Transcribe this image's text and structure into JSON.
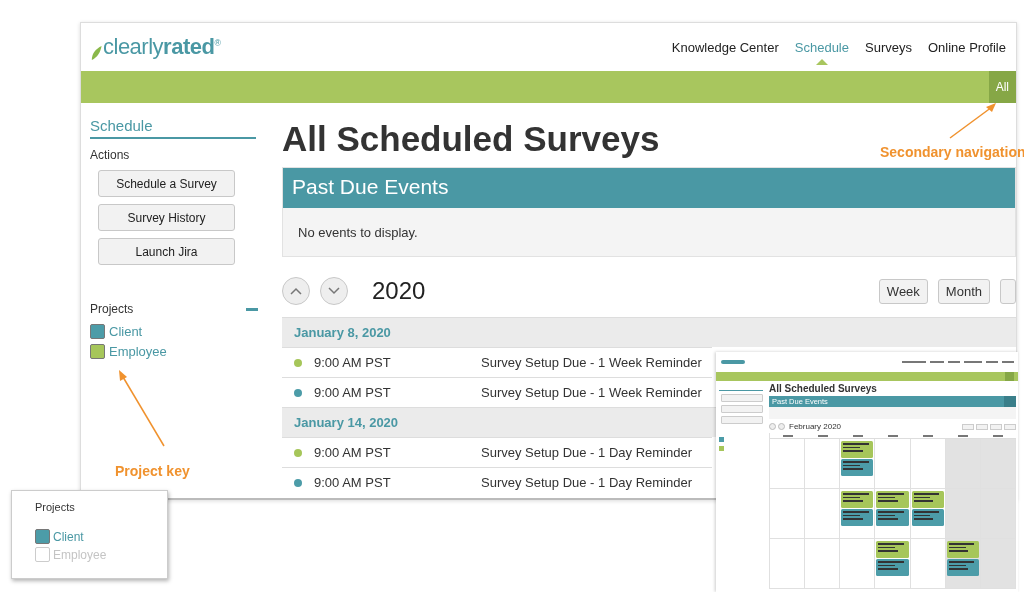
{
  "header": {
    "logo": "clearly**rated**$^{®}$",
    "nav": [
      {
        "label": "Knowledge Center",
        "selected": false
      },
      {
        "label": "Schedule",
        "selected": true
      },
      {
        "label": "Surveys",
        "selected": false
      },
      {
        "label": "Online Profile",
        "selected": false
      }
    ],
    "subnav": [
      {
        "label": "All",
        "selected": true
      }
    ]
  },
  "sidebar": {
    "title": "Schedule",
    "actions_label": "Actions",
    "actions": [
      "Schedule a Survey",
      "Survey History",
      "Launch Jira"
    ],
    "projects_label": "Projects",
    "projects": [
      {
        "label": "Client",
        "color": "#4c9ca8"
      },
      {
        "label": "Employee",
        "color": "#a6c65a"
      }
    ]
  },
  "page_title": "All Scheduled Surveys",
  "past_due": {
    "title": "Past Due Events",
    "empty": "No events to display."
  },
  "calendar": {
    "year": "2020",
    "views": [
      "Week",
      "Month"
    ],
    "groups": [
      {
        "date": "January 8, 2020",
        "events": [
          {
            "time": "9:00 AM PST",
            "title": "Survey Setup Due - 1 Week Reminder",
            "color": "#a6c65a"
          },
          {
            "time": "9:00 AM PST",
            "title": "Survey Setup Due - 1 Week Reminder",
            "color": "#4c9ca8"
          }
        ]
      },
      {
        "date": "January 14, 2020",
        "events": [
          {
            "time": "9:00 AM PST",
            "title": "Survey Setup Due - 1 Day Reminder",
            "color": "#a6c65a"
          },
          {
            "time": "9:00 AM PST",
            "title": "Survey Setup Due - 1 Day Reminder",
            "color": "#4c9ca8"
          }
        ]
      }
    ]
  },
  "annotations": [
    {
      "text": "Secondary navigation"
    },
    {
      "text": "Project key"
    }
  ],
  "projects_inset": {
    "title": "Projects",
    "items": [
      {
        "label": "Client",
        "checked": true,
        "color": "#4c9ca8"
      },
      {
        "label": "Employee",
        "checked": false
      }
    ]
  },
  "month_inset": {
    "page_title": "All Scheduled Surveys",
    "past_due_title": "Past Due Events",
    "month": "February 2020",
    "projects": [
      {
        "color": "#4c9ca8"
      },
      {
        "color": "#a6c65a"
      }
    ],
    "weeks": [
      [
        {
          "weekend": false
        },
        {
          "weekend": false
        },
        {
          "weekend": false,
          "events": [
            {
              "color": "#a6c65a"
            },
            {
              "color": "#4c9ca8"
            }
          ]
        },
        {
          "weekend": false
        },
        {
          "weekend": false
        },
        {
          "weekend": true
        },
        {
          "weekend": true
        }
      ],
      [
        {
          "weekend": false
        },
        {
          "weekend": false
        },
        {
          "weekend": false,
          "events": [
            {
              "color": "#a6c65a"
            },
            {
              "color": "#4c9ca8"
            }
          ]
        },
        {
          "weekend": false,
          "events": [
            {
              "color": "#a6c65a"
            },
            {
              "color": "#4c9ca8"
            }
          ]
        },
        {
          "weekend": false,
          "events": [
            {
              "color": "#a6c65a"
            },
            {
              "color": "#4c9ca8"
            }
          ]
        },
        {
          "weekend": true
        },
        {
          "weekend": true
        }
      ],
      [
        {
          "weekend": false
        },
        {
          "weekend": false
        },
        {
          "weekend": false
        },
        {
          "weekend": false,
          "events": [
            {
              "color": "#a6c65a"
            },
            {
              "color": "#4c9ca8"
            }
          ]
        },
        {
          "weekend": false
        },
        {
          "weekend": true,
          "events": [
            {
              "color": "#a6c65a"
            },
            {
              "color": "#4c9ca8"
            }
          ]
        },
        {
          "weekend": true
        }
      ]
    ]
  }
}
